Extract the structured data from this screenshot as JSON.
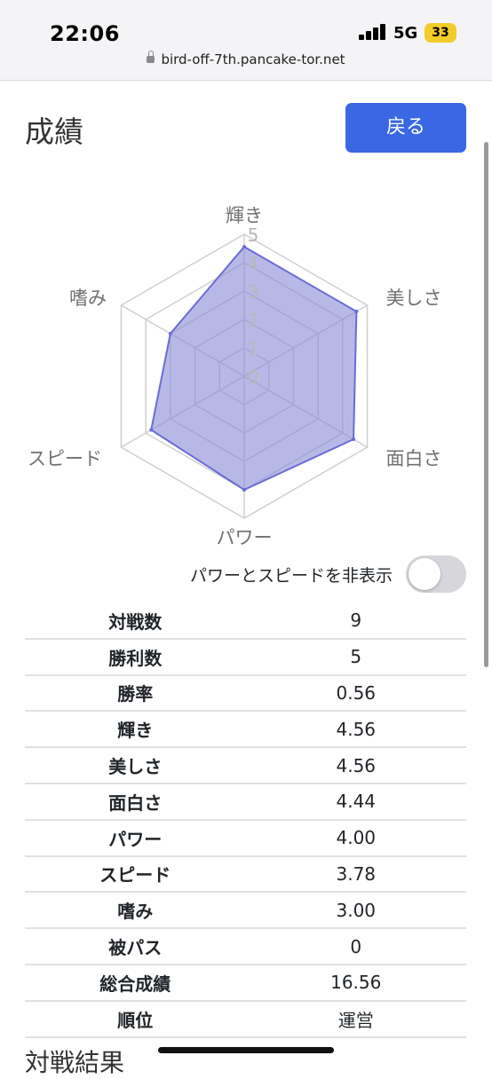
{
  "status_bar": {
    "time": "22:06",
    "network": "5G",
    "battery": "33"
  },
  "browser": {
    "url": "bird-off-7th.pancake-tor.net"
  },
  "header": {
    "title": "成績",
    "back_label": "戻る"
  },
  "radar": {
    "axes": [
      "輝き",
      "美しさ",
      "面白さ",
      "パワー",
      "スピード",
      "嗜み"
    ],
    "ticks": [
      "0",
      "1",
      "2",
      "3",
      "4",
      "5"
    ],
    "max": 5,
    "values": [
      4.56,
      4.56,
      4.44,
      4.0,
      3.78,
      3.0
    ],
    "fill_color": "#8c8cd9",
    "stroke_color": "#6b6bd6",
    "grid_color": "#d0d0d0"
  },
  "toggle": {
    "label": "パワーとスピードを非表示",
    "on": false
  },
  "stats": [
    {
      "label": "対戦数",
      "value": "9"
    },
    {
      "label": "勝利数",
      "value": "5"
    },
    {
      "label": "勝率",
      "value": "0.56"
    },
    {
      "label": "輝き",
      "value": "4.56"
    },
    {
      "label": "美しさ",
      "value": "4.56"
    },
    {
      "label": "面白さ",
      "value": "4.44"
    },
    {
      "label": "パワー",
      "value": "4.00"
    },
    {
      "label": "スピード",
      "value": "3.78"
    },
    {
      "label": "嗜み",
      "value": "3.00"
    },
    {
      "label": "被パス",
      "value": "0"
    },
    {
      "label": "総合成績",
      "value": "16.56"
    },
    {
      "label": "順位",
      "value": "運営"
    }
  ],
  "next_section": {
    "title": "対戦結果"
  }
}
